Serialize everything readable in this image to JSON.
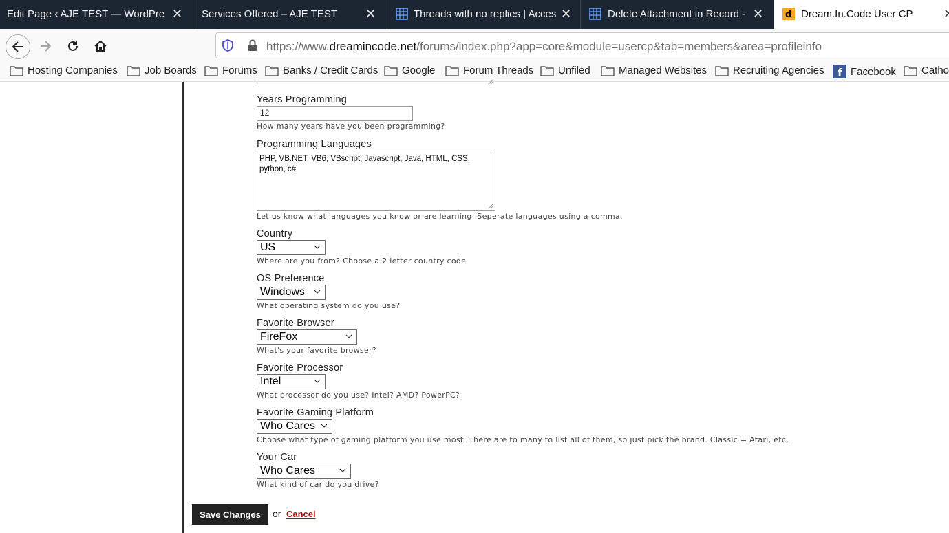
{
  "tabs": [
    {
      "label": "Edit Page ‹ AJE TEST — WordPress",
      "active": false,
      "icon": "none"
    },
    {
      "label": "Services Offered – AJE TEST",
      "active": false,
      "icon": "none"
    },
    {
      "label": "Threads with no replies | Access",
      "active": false,
      "icon": "grid-icon"
    },
    {
      "label": "Delete Attachment in Record -",
      "active": false,
      "icon": "grid-icon"
    },
    {
      "label": "Dream.In.Code User CP",
      "active": true,
      "icon": "dream-in-code-icon"
    }
  ],
  "url": {
    "prefix": "https://www.",
    "domain": "dreamincode.net",
    "path": "/forums/index.php?app=core&module=usercp&tab=members&area=profileinfo"
  },
  "bookmarks": [
    "Hosting Companies",
    "Job Boards",
    "Forums",
    "Banks / Credit Cards",
    "Google",
    "Forum Threads",
    "Unfiled",
    "Managed Websites",
    "Recruiting Agencies",
    "Facebook",
    "Catho"
  ],
  "form": {
    "years": {
      "label": "Years Programming",
      "value": "12",
      "hint": "How many years have you been programming?"
    },
    "languages": {
      "label": "Programming Languages",
      "value": "PHP, VB.NET, VB6, VBscript, Javascript, Java, HTML, CSS, python, c#",
      "hint": "Let us know what languages you know or are learning. Seperate languages using a comma."
    },
    "country": {
      "label": "Country",
      "value": "US",
      "hint": "Where are you from? Choose a 2 letter country code"
    },
    "os": {
      "label": "OS Preference",
      "value": "Windows",
      "hint": "What operating system do you use?"
    },
    "browser": {
      "label": "Favorite Browser",
      "value": "FireFox",
      "hint": "What's your favorite browser?"
    },
    "processor": {
      "label": "Favorite Processor",
      "value": "Intel",
      "hint": "What processor do you use? Intel? AMD? PowerPC?"
    },
    "gaming": {
      "label": "Favorite Gaming Platform",
      "value": "Who Cares",
      "hint": "Choose what type of gaming platform you use most. There are to many to list all of them, so just pick the brand. Classic = Atari, etc."
    },
    "car": {
      "label": "Your Car",
      "value": "Who Cares",
      "hint": "What kind of car do you drive?"
    }
  },
  "actions": {
    "save": "Save Changes",
    "or": "or",
    "cancel": "Cancel"
  }
}
